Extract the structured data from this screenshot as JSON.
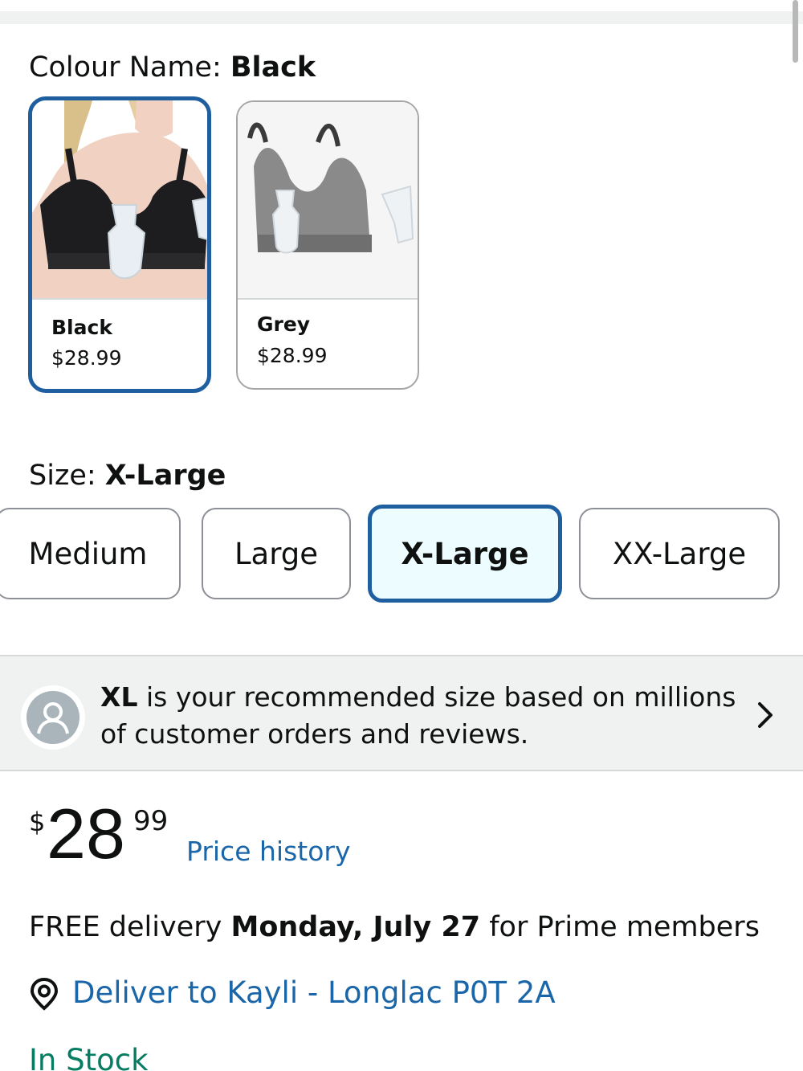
{
  "colour": {
    "label": "Colour Name: ",
    "selected": "Black",
    "options": [
      {
        "name": "Black",
        "price": "$28.99",
        "selected": true,
        "image": "black-nursing-bra-with-pump-image"
      },
      {
        "name": "Grey",
        "price": "$28.99",
        "selected": false,
        "image": "grey-nursing-bra-with-pump-image"
      }
    ]
  },
  "size": {
    "label": "Size: ",
    "selected": "X-Large",
    "options": [
      "Medium",
      "Large",
      "X-Large",
      "XX-Large"
    ]
  },
  "recommendation": {
    "bold": "XL",
    "text": " is your recommended size based on millions of customer orders and reviews.",
    "icon": "avatar-icon"
  },
  "price": {
    "symbol": "$",
    "whole": "28",
    "fraction": "99",
    "history_link": "Price history"
  },
  "delivery": {
    "prefix": "FREE delivery ",
    "date": "Monday, July 27",
    "suffix": " for Prime members"
  },
  "location": {
    "icon": "location-pin-icon",
    "text": "Deliver to Kayli - Longlac P0T 2A"
  },
  "stock": {
    "text": "In Stock"
  },
  "colors": {
    "accent_blue": "#1f5f9f",
    "link_blue": "#1a66a8",
    "selected_bg": "#edfdff",
    "in_stock_green": "#067d62",
    "panel_gray": "#f0f2f2"
  }
}
